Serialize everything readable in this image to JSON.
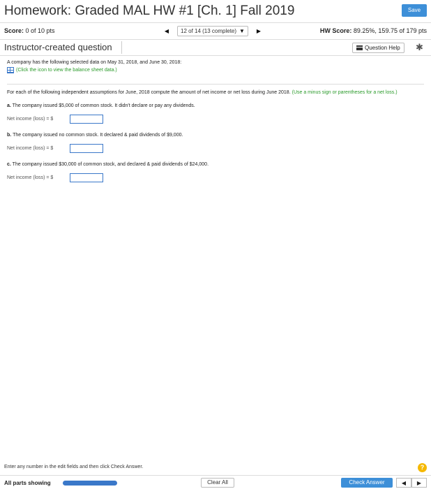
{
  "header": {
    "title": "Homework: Graded MAL HW #1 [Ch. 1] Fall 2019",
    "save_label": "Save"
  },
  "score_bar": {
    "score_label": "Score:",
    "score_value": "0 of 10 pts",
    "nav_position": "12 of 14 (13 complete)",
    "hw_score_label": "HW Score:",
    "hw_score_value": "89.25%, 159.75 of 179 pts"
  },
  "question_bar": {
    "type_label": "Instructor-created question",
    "help_label": "Question Help"
  },
  "question": {
    "intro": "A company has the following selected data on May 31, 2018, and June 30, 2018:",
    "sheet_link": "(Click the icon to view the balance sheet data.)",
    "instruction": "For each of the following independent assumptions for June, 2018 compute the amount of net income or net loss during June 2018.",
    "instruction_hint": "(Use a minus sign or parentheses for a net loss.)",
    "parts": [
      {
        "letter": "a.",
        "text": "The company issued $5,000 of common stock. It didn't declare or pay any dividends.",
        "answer_label": "Net income (loss) = $",
        "answer_value": ""
      },
      {
        "letter": "b.",
        "text": "The company issued no common stock. It declared & paid dividends of $9,000.",
        "answer_label": "Net income (loss) = $",
        "answer_value": ""
      },
      {
        "letter": "c.",
        "text": "The company issued $30,000 of common stock, and declared & paid dividends of $24,000.",
        "answer_label": "Net income (loss) = $",
        "answer_value": ""
      }
    ]
  },
  "footer": {
    "message": "Enter any number in the edit fields and then click Check Answer.",
    "parts_showing": "All parts showing",
    "clear_label": "Clear All",
    "check_label": "Check Answer"
  },
  "colors": {
    "accent": "#3d8fd8",
    "link_green": "#2a9a2a",
    "help_yellow": "#f5b800"
  }
}
